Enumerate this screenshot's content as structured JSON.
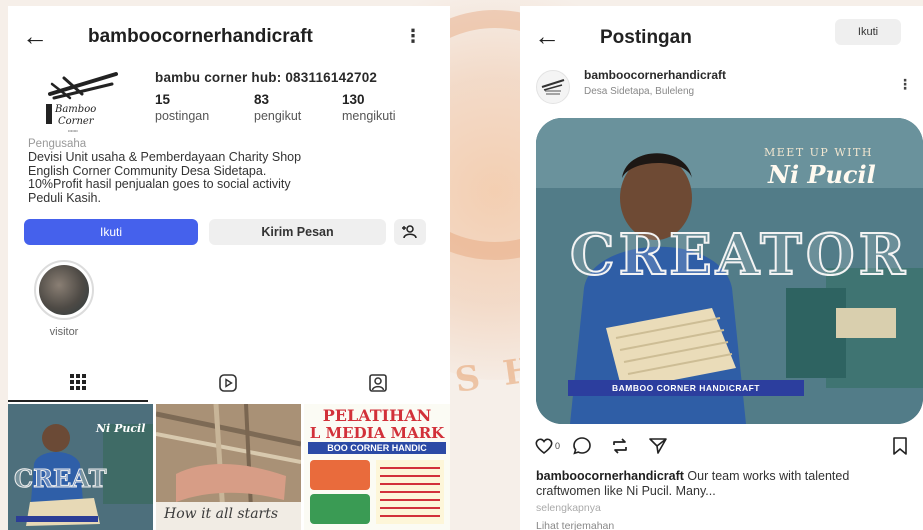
{
  "profile": {
    "username": "bamboocornerhandicraft",
    "display_name": "bambu corner hub: 083116142702",
    "stats": [
      {
        "count": "15",
        "label": "postingan"
      },
      {
        "count": "83",
        "label": "pengikut"
      },
      {
        "count": "130",
        "label": "mengikuti"
      }
    ],
    "category": "Pengusaha",
    "bio_lines": [
      "Devisi Unit usaha & Pemberdayaan Charity Shop",
      "English Corner Community Desa Sidetapa.",
      "10%Profit hasil penjualan goes to social activity",
      "Peduli Kasih."
    ],
    "follow_label": "Ikuti",
    "message_label": "Kirim Pesan",
    "highlight_label": "visitor",
    "avatar_logo_text": [
      "Bamboo",
      "Corner"
    ],
    "tiles": {
      "tile1_text": "Ni Pucil",
      "tile1_overlay": "CREAT",
      "tile2_text": "How it all starts",
      "tile3_title_1": "PELATIHAN",
      "tile3_title_2": "L MEDIA MARK",
      "tile3_title_3": "BOO CORNER HANDIC"
    }
  },
  "post": {
    "header_title": "Postingan",
    "follow_label": "Ikuti",
    "username": "bamboocornerhandicraft",
    "location": "Desa Sidetapa, Buleleng",
    "image": {
      "meet_text": "MEET UP WITH",
      "name": "Ni Pucil",
      "headline": "CREATOR",
      "brand": "BAMBOO CORNER HANDICRAFT"
    },
    "like_count": "0",
    "caption_user": "bamboocornerhandicraft",
    "caption_text": "Our team works with talented craftwomen like Ni Pucil. Many...",
    "more_label": "selengkapnya",
    "translation_label": "Lihat terjemahan"
  },
  "colors": {
    "primary_button": "#4561ec",
    "secondary_button": "#efefef",
    "background": "#f6efe9"
  },
  "icons": [
    "back-arrow-icon",
    "more-vertical-icon",
    "add-user-icon",
    "grid-icon",
    "reels-icon",
    "tagged-icon",
    "heart-icon",
    "comment-icon",
    "repost-icon",
    "share-icon",
    "bookmark-icon"
  ]
}
